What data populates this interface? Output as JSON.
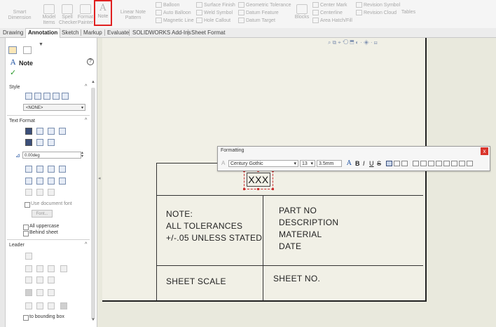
{
  "ribbon": {
    "big_items": [
      {
        "label": "Smart Dimension",
        "icon": "smart-dimension-icon"
      },
      {
        "label": "Model Items",
        "icon": "model-items-icon"
      },
      {
        "label": "Spell Checker",
        "icon": "spell-checker-icon"
      },
      {
        "label": "Format Painter",
        "icon": "format-painter-icon"
      },
      {
        "label": "Note",
        "icon": "note-icon"
      },
      {
        "label": "Linear Note Pattern",
        "icon": "linear-note-pattern-icon"
      }
    ],
    "col1": [
      "Balloon",
      "Auto Balloon",
      "Magnetic Line"
    ],
    "col2": [
      "Surface Finish",
      "Weld Symbol",
      "Hole Callout"
    ],
    "col3": [
      "Geometric Tolerance",
      "Datum Feature",
      "Datum Target"
    ],
    "blocks_label": "Blocks",
    "col4": [
      "Center Mark",
      "Centerline",
      "Area Hatch/Fill"
    ],
    "col5": [
      "Revision Symbol",
      "Revision Cloud"
    ],
    "tables_label": "Tables"
  },
  "tabs": [
    "Drawing",
    "Annotation",
    "Sketch",
    "Markup",
    "Evaluate",
    "SOLIDWORKS Add-Ins",
    "Sheet Format"
  ],
  "active_tab": "Annotation",
  "panel": {
    "title": "Note",
    "help": "?",
    "ok": "✓",
    "style_label": "Style",
    "style_value": "<NONE>",
    "text_format_label": "Text Format",
    "angle_value": "0.00deg",
    "use_doc_font": "Use document font",
    "font_button": "Font...",
    "all_uppercase": "All uppercase",
    "behind_sheet": "Behind sheet",
    "leader_label": "Leader",
    "to_bounding_box": "to bounding box"
  },
  "formatting": {
    "title": "Formatting",
    "font": "Century Gothic",
    "size": "13",
    "height": "3.5mm",
    "close": "x",
    "buttons": [
      "A",
      "B",
      "I",
      "U",
      "S"
    ]
  },
  "note_text": "XXX",
  "title_block": {
    "note_lines": [
      "NOTE:",
      "ALL TOLERANCES",
      "+/-.05 UNLESS STATED"
    ],
    "right_lines": [
      "PART NO",
      "DESCRIPTION",
      "MATERIAL",
      "DATE"
    ],
    "sheet_scale": "SHEET SCALE",
    "sheet_no": "SHEET NO."
  }
}
